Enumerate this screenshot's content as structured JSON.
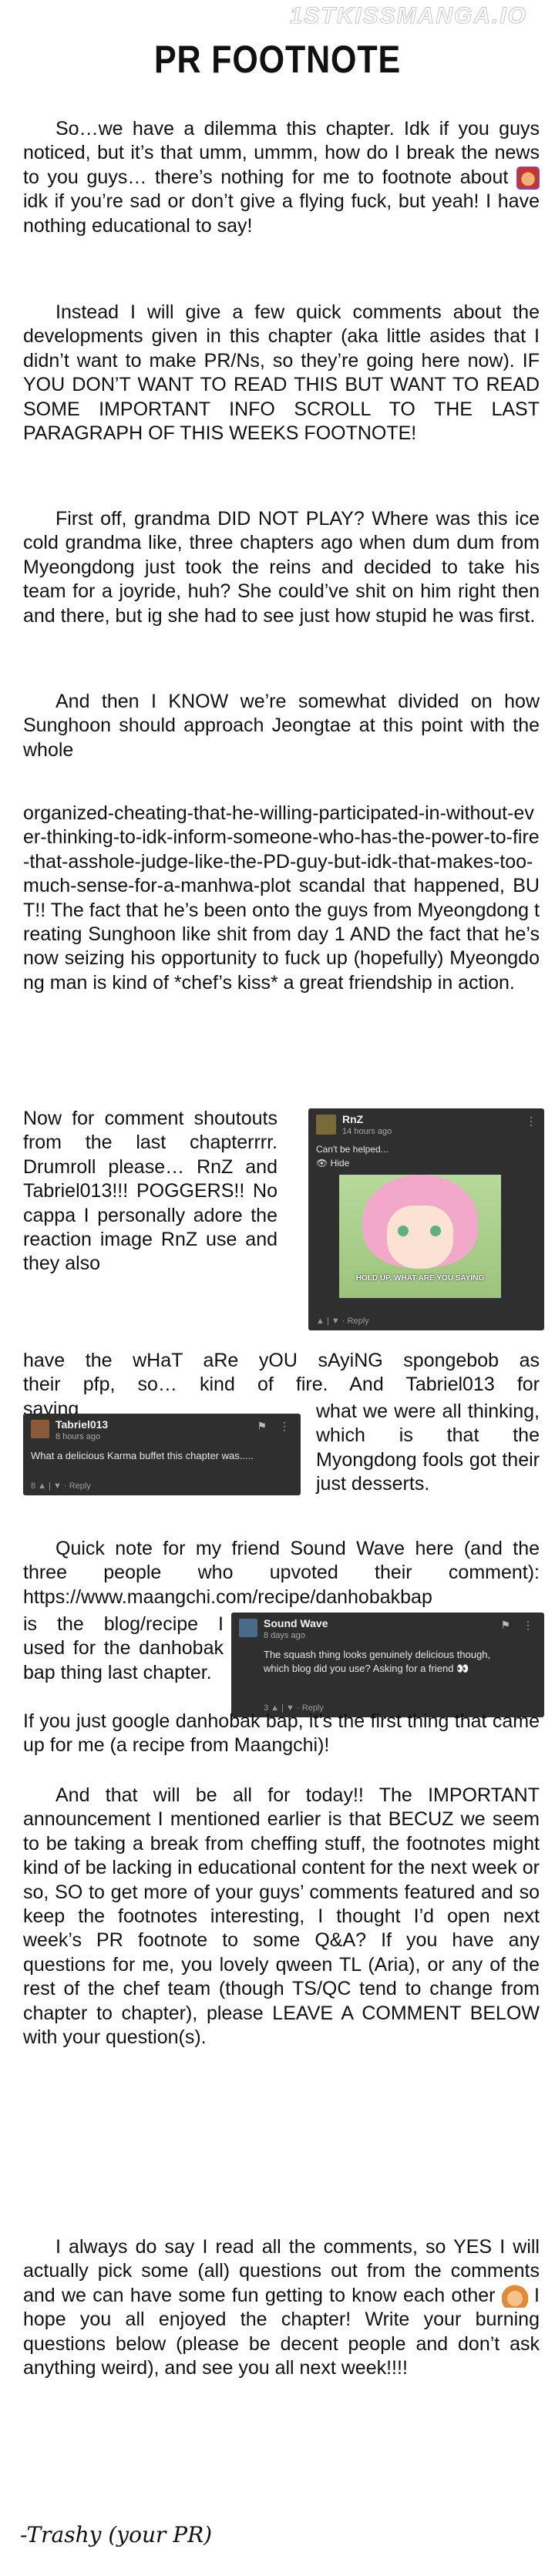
{
  "watermark": "1STKISSMANGA.IO",
  "title": "PR FOOTNOTE",
  "p1": "So…we have a dilemma this chapter. Idk if you guys noticed, but it’s that umm, ummm, how do I break the news to you guys… there’s nothing for me to footnote about",
  "p1_end": "idk if you’re sad or don’t give a flying fuck, but yeah! I have nothing educational to say!",
  "p2": "Instead I will give a few quick comments about the developments given in this chapter (aka little asides that I didn’t want to make PR/Ns, so they’re going here now). IF YOU DON’T WANT TO READ THIS BUT WANT TO READ SOME IMPORTANT INFO SCROLL TO THE LAST PARAGRAPH OF THIS WEEKS FOOTNOTE!",
  "p3": "First off, grandma DID NOT PLAY? Where was this ice cold grandma like, three chapters ago when dum dum from Myeongdong just took the reins and decided to take his team for a joyride, huh? She could’ve shit on him right then and there, but ig she had to see just how stupid he was first.",
  "p4a": "And then I KNOW we’re somewhat divided on how Sunghoon should approach Jeongtae at this point with the whole",
  "p4b": "organized-cheating-that-he-willing-participated-in-without-ever-thinking-to-idk-inform-someone-who-has-the-power-to-fire-that-asshole-judge-like-the-PD-guy-but-idk-that-makes-too-much-sense-for-a-manhwa-plot scandal that happened, BUT!! The fact that he’s been onto the guys from Myeongdong treating Sunghoon like shit from day 1 AND the fact that he’s now seizing his opportunity to fuck up (hopefully) Myeongdong man is kind of *chef’s kiss* a great friendship in action.",
  "p5a": "Now for comment shoutouts from the last chapterrrr. Drumroll please… RnZ and Tabriel013!!! POGGERS!! No cappa I personally adore the reaction image RnZ use and they also",
  "p5b": "have the wHaT aRe yOU sAyiNG spongebob as their pfp, so… kind of fire. And Tabriel013 for saying",
  "p5c": "what we were all thinking, which is that the Myongdong fools got their just desserts.",
  "p6a": "Quick note for my friend Sound Wave here (and the three people who upvoted their comment): https://www.maangchi.com/recipe/danhobakbap",
  "p6b": "is the blog/recipe I used for the danhobak bap thing last chapter.",
  "p6c": "If you just google danhobak bap, it’s the first thing that came up for me (a recipe from Maangchi)!",
  "p7": "And that will be all for today!! The IMPORTANT announcement I mentioned earlier is that BECUZ we seem to be taking a break from cheffing stuff, the footnotes might kind of be lacking in educational content for the next week or so, SO to get more of your guys’ comments featured and so keep the footnotes interesting, I thought I’d open next week’s PR footnote to some Q&A? If you have any questions for me, you lovely qween TL (Aria), or any of the rest of the chef team (though TS/QC tend to change from chapter to chapter), please LEAVE A COMMENT BELOW with your question(s).",
  "p8a": "I always do say I read all the comments, so YES I will actually pick some (all) questions out from the comments and we can have some fun getting to know each other",
  "p8b": "I hope you all enjoyed the chapter! Write your burning questions below (please be decent people and don’t ask anything weird), and see you all next week!!!!",
  "signature": "-Trashy (your PR)",
  "comment_rnz": {
    "name": "RnZ",
    "time": "14 hours ago",
    "text": "Can't be helped...",
    "hide": "Hide",
    "caption": "HOLD UP, WHAT ARE YOU SAYING",
    "actions": "Reply"
  },
  "comment_tabriel": {
    "name": "Tabriel013",
    "time": "8 hours ago",
    "text": "What a delicious Karma buffet this chapter was.....",
    "votes": "8",
    "actions": "Reply"
  },
  "comment_soundwave": {
    "name": "Sound Wave",
    "time": "8 days ago",
    "text": "The squash thing looks genuinely delicious though, which blog did you use? Asking for a friend 👀",
    "votes": "3",
    "actions": "Reply"
  },
  "colors": {
    "card_bg": "#2f2f2f",
    "text": "#111111",
    "page_bg": "#ffffff"
  }
}
